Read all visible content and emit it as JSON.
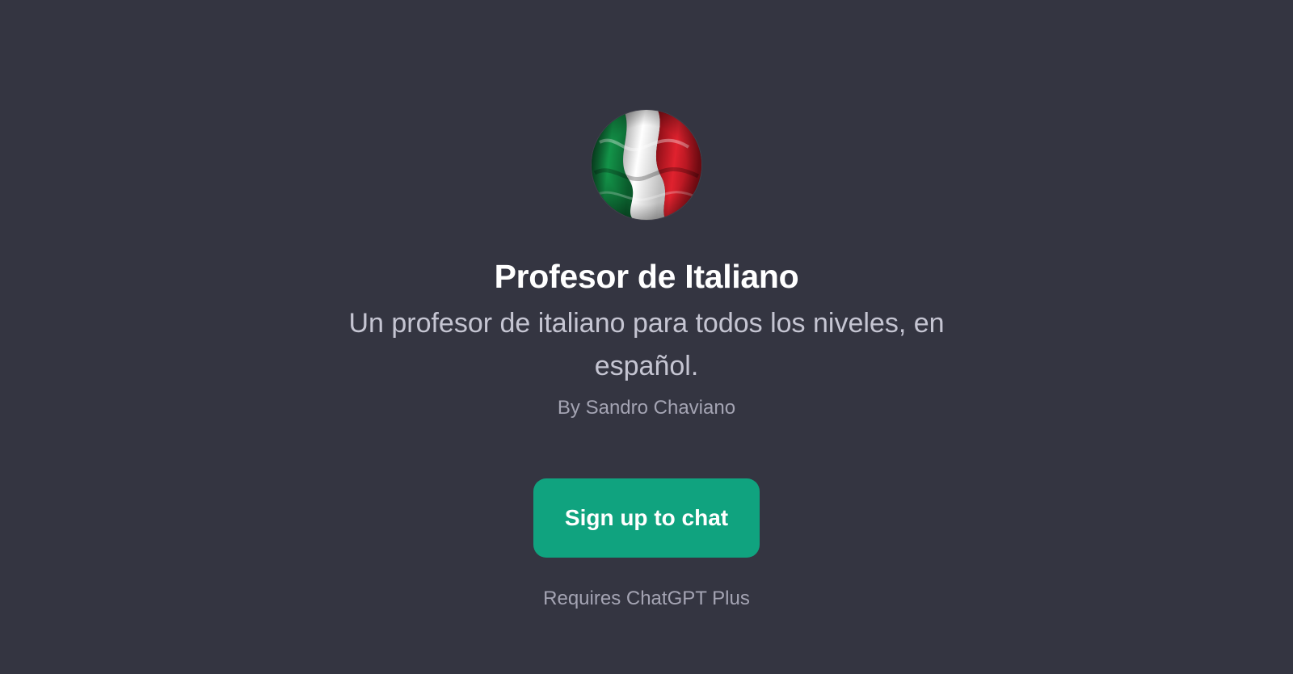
{
  "gpt": {
    "title": "Profesor de Italiano",
    "description": "Un profesor de italiano para todos los niveles, en español.",
    "author": "By Sandro Chaviano",
    "avatar_icon": "italian-flag-avatar",
    "avatar_colors": [
      "#0e7a3a",
      "#f2f2f2",
      "#c9121f"
    ]
  },
  "cta": {
    "signup_label": "Sign up to chat",
    "requirement": "Requires ChatGPT Plus",
    "accent": "#10a37f"
  },
  "theme": {
    "background": "#343541"
  }
}
